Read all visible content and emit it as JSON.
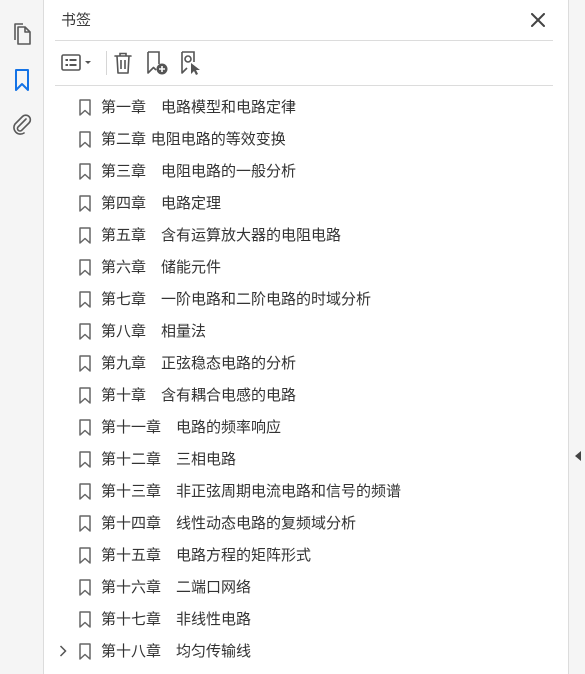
{
  "panel": {
    "title": "书签"
  },
  "rail": {
    "icons": [
      "pages-icon",
      "bookmark-icon",
      "paperclip-icon"
    ],
    "active": "bookmark-icon",
    "active_color": "#1473e6"
  },
  "toolbar": {
    "icons": [
      "options-menu-icon",
      "delete-bookmark-icon",
      "new-bookmark-icon",
      "bookmark-from-structure-icon"
    ]
  },
  "bookmarks": [
    {
      "label": "第一章　电路模型和电路定律"
    },
    {
      "label": "第二章 电阻电路的等效变换"
    },
    {
      "label": "第三章　电阻电路的一般分析"
    },
    {
      "label": "第四章　电路定理"
    },
    {
      "label": "第五章　含有运算放大器的电阻电路"
    },
    {
      "label": "第六章　储能元件"
    },
    {
      "label": "第七章　一阶电路和二阶电路的时域分析"
    },
    {
      "label": "第八章　相量法"
    },
    {
      "label": "第九章　正弦稳态电路的分析"
    },
    {
      "label": "第十章　含有耦合电感的电路"
    },
    {
      "label": "第十一章　电路的频率响应"
    },
    {
      "label": "第十二章　三相电路"
    },
    {
      "label": "第十三章　非正弦周期电流电路和信号的频谱"
    },
    {
      "label": "第十四章　线性动态电路的复频域分析"
    },
    {
      "label": "第十五章　电路方程的矩阵形式"
    },
    {
      "label": "第十六章　二端口网络"
    },
    {
      "label": "第十七章　非线性电路"
    },
    {
      "label": "第十八章　均匀传输线",
      "expandable": true
    }
  ]
}
